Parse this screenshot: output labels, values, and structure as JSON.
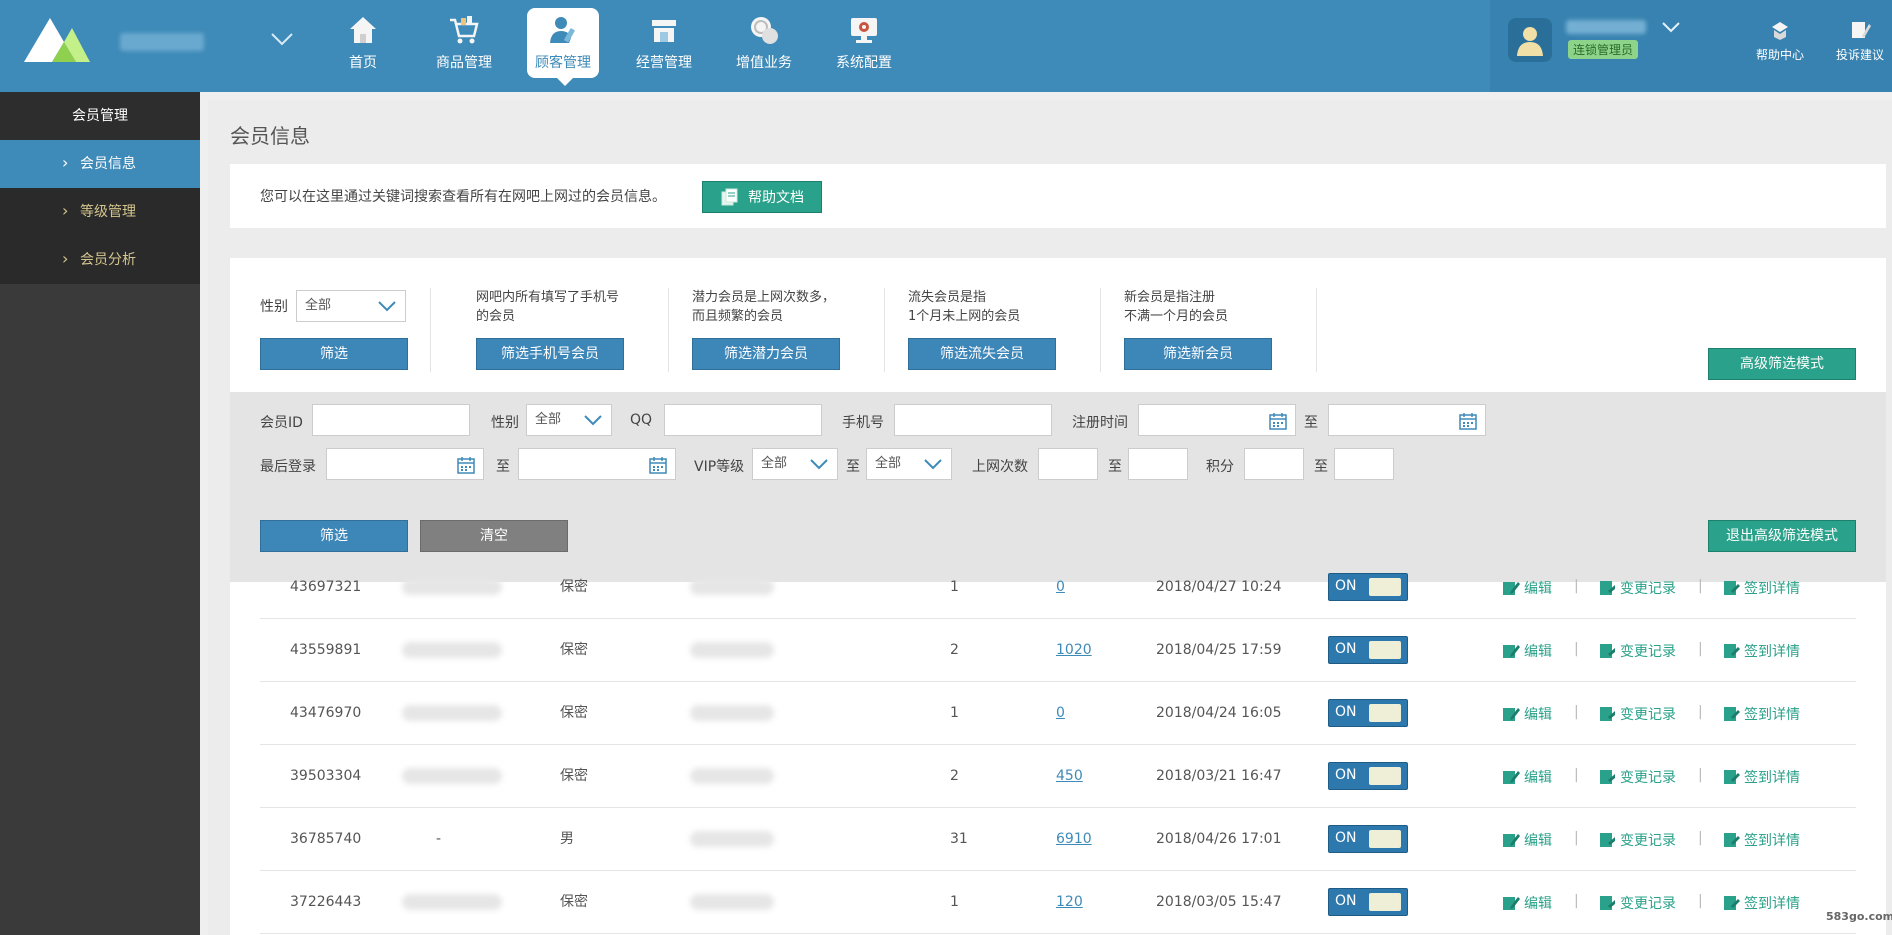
{
  "header": {
    "nav": [
      {
        "label": "首页",
        "icon": "home-icon"
      },
      {
        "label": "商品管理",
        "icon": "cart-icon"
      },
      {
        "label": "顾客管理",
        "icon": "customer-icon",
        "active": true
      },
      {
        "label": "经营管理",
        "icon": "store-icon"
      },
      {
        "label": "增值业务",
        "icon": "coins-icon"
      },
      {
        "label": "系统配置",
        "icon": "monitor-gear-icon"
      }
    ],
    "role_badge": "连锁管理员",
    "help_center": "帮助中心",
    "feedback": "投诉建议"
  },
  "sidebar": {
    "title": "会员管理",
    "items": [
      {
        "label": "会员信息",
        "active": true
      },
      {
        "label": "等级管理"
      },
      {
        "label": "会员分析"
      }
    ]
  },
  "page": {
    "title": "会员信息",
    "info_text": "您可以在这里通过关键词搜索查看所有在网吧上网过的会员信息。",
    "help_doc_button": "帮助文档"
  },
  "quick_filter": {
    "gender_label": "性别",
    "gender_value": "全部",
    "filter_button": "筛选",
    "groups": [
      {
        "desc_line1": "网吧内所有填写了手机号",
        "desc_line2": "的会员",
        "button": "筛选手机号会员"
      },
      {
        "desc_line1": "潜力会员是上网次数多，",
        "desc_line2": "而且频繁的会员",
        "button": "筛选潜力会员"
      },
      {
        "desc_line1": "流失会员是指",
        "desc_line2": "1个月未上网的会员",
        "button": "筛选流失会员"
      },
      {
        "desc_line1": "新会员是指注册",
        "desc_line2": "不满一个月的会员",
        "button": "筛选新会员"
      }
    ],
    "advanced_mode_button": "高级筛选模式"
  },
  "advanced_filter": {
    "member_id_label": "会员ID",
    "gender_label": "性别",
    "gender_value": "全部",
    "qq_label": "QQ",
    "phone_label": "手机号",
    "register_time_label": "注册时间",
    "to_label": "至",
    "last_login_label": "最后登录",
    "vip_label": "VIP等级",
    "vip_from": "全部",
    "vip_to": "全部",
    "visits_label": "上网次数",
    "points_label": "积分",
    "filter_button": "筛选",
    "clear_button": "清空",
    "exit_button": "退出高级筛选模式"
  },
  "table": {
    "toggle_label": "ON",
    "actions": {
      "edit": "编辑",
      "history": "变更记录",
      "checkin": "签到详情",
      "separator": "|"
    },
    "rows": [
      {
        "id": "43697321",
        "name": "",
        "gender": "保密",
        "visits": "1",
        "points": "0",
        "last_login": "2018/04/27 10:24"
      },
      {
        "id": "43559891",
        "name": "",
        "gender": "保密",
        "visits": "2",
        "points": "1020",
        "last_login": "2018/04/25 17:59"
      },
      {
        "id": "43476970",
        "name": "",
        "gender": "保密",
        "visits": "1",
        "points": "0",
        "last_login": "2018/04/24 16:05"
      },
      {
        "id": "39503304",
        "name": "",
        "gender": "保密",
        "visits": "2",
        "points": "450",
        "last_login": "2018/03/21 16:47"
      },
      {
        "id": "36785740",
        "name": "-",
        "gender": "男",
        "visits": "31",
        "points": "6910",
        "last_login": "2018/04/26 17:01"
      },
      {
        "id": "37226443",
        "name": "",
        "gender": "保密",
        "visits": "1",
        "points": "120",
        "last_login": "2018/03/05 15:47"
      }
    ]
  },
  "watermark": "583go.com",
  "colors": {
    "primary": "#3e8ab8",
    "accent": "#2aa18a",
    "sidebar": "#3a3a3a",
    "neutral_button": "#808080"
  }
}
